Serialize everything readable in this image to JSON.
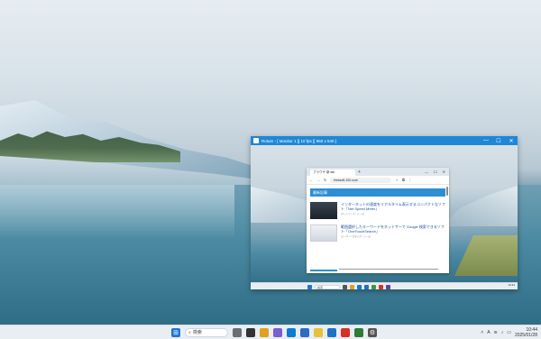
{
  "taskbar": {
    "search_label": "検索",
    "clock_time": "10:44",
    "clock_date": "2025/01/28",
    "lang": "A"
  },
  "window": {
    "title": "Rotum - [ Monitor 1 ][ 10 fps ][ 960 x 540 ]",
    "minimize": "—",
    "maximize": "☐",
    "close": "✕"
  },
  "browser": {
    "tab_title": "ブラウザ 新 tab",
    "url": "freesoft-100.com",
    "section_header": "最新記事",
    "articles": [
      {
        "title": "インターネットの速度をリアルタイム表示するコンパクトなソフト「Net Speed Meter」",
        "meta": "[ネットワーク / ツール]"
      },
      {
        "title": "範囲選択したキーワードをネットサーで Google 検索できるソフト「OneTouchSearch」",
        "meta": "[ユーザー / 文字入力 / ツール]"
      }
    ]
  },
  "mini_taskbar": {
    "search_label": "検索",
    "clock": "10:44"
  },
  "colors": {
    "accent": "#1f87d6",
    "header_blue": "#2c8fd4"
  }
}
